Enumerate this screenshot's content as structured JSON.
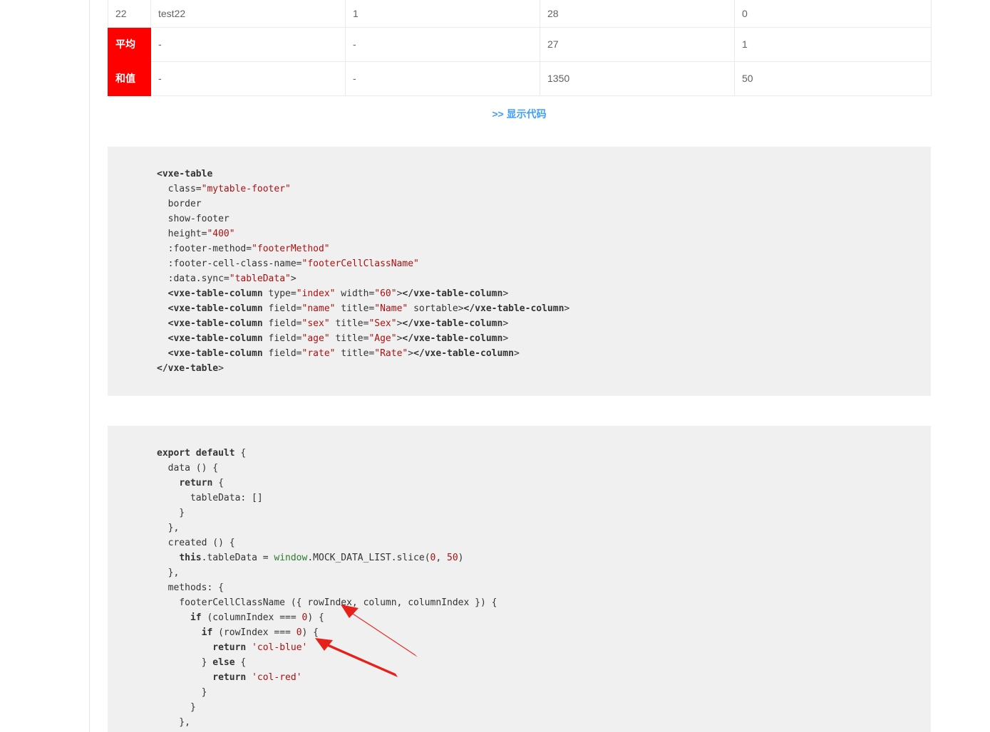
{
  "table": {
    "rows": [
      {
        "c0": "22",
        "c1": "test22",
        "c2": "1",
        "c3": "28",
        "c4": "0"
      }
    ],
    "footer": [
      {
        "label": "平均",
        "c1": "-",
        "c2": "-",
        "c3": "27",
        "c4": "1"
      },
      {
        "label": "和值",
        "c1": "-",
        "c2": "-",
        "c3": "1350",
        "c4": "50"
      }
    ]
  },
  "show_code_link": ">> 显示代码",
  "template_code": [
    "<vxe-table",
    "  class=\"mytable-footer\"",
    "  border",
    "  show-footer",
    "  height=\"400\"",
    "  :footer-method=\"footerMethod\"",
    "  :footer-cell-class-name=\"footerCellClassName\"",
    "  :data.sync=\"tableData\">",
    "  <vxe-table-column type=\"index\" width=\"60\"></vxe-table-column>",
    "  <vxe-table-column field=\"name\" title=\"Name\" sortable></vxe-table-column>",
    "  <vxe-table-column field=\"sex\" title=\"Sex\"></vxe-table-column>",
    "  <vxe-table-column field=\"age\" title=\"Age\"></vxe-table-column>",
    "  <vxe-table-column field=\"rate\" title=\"Rate\"></vxe-table-column>",
    "</vxe-table>"
  ],
  "script_code": [
    "export default {",
    "  data () {",
    "    return {",
    "      tableData: []",
    "    }",
    "  },",
    "  created () {",
    "    this.tableData = window.MOCK_DATA_LIST.slice(0, 50)",
    "  },",
    "  methods: {",
    "    footerCellClassName ({ rowIndex, column, columnIndex }) {",
    "      if (columnIndex === 0) {",
    "        if (rowIndex === 0) {",
    "          return 'col-blue'",
    "        } else {",
    "          return 'col-red'",
    "        }",
    "      }",
    "    },"
  ],
  "colors": {
    "footer_red": "#ff0000",
    "link_blue": "#409eff",
    "code_bg": "#f0f0f0",
    "arrow_red": "#e8201a"
  }
}
